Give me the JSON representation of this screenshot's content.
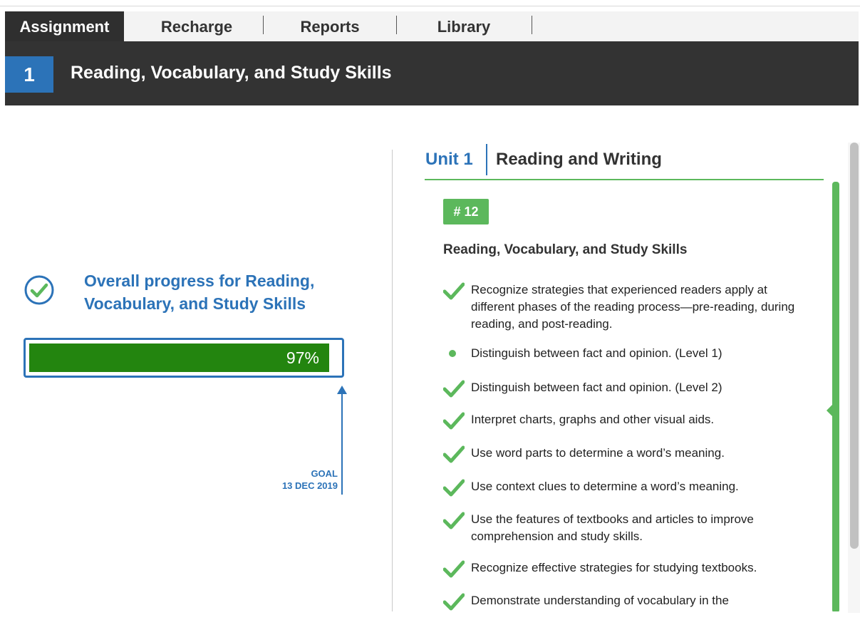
{
  "tabs": [
    {
      "label": "Assignment",
      "active": true
    },
    {
      "label": "Recharge",
      "active": false
    },
    {
      "label": "Reports",
      "active": false
    },
    {
      "label": "Library",
      "active": false
    }
  ],
  "header": {
    "number": "1",
    "title": "Reading, Vocabulary, and Study Skills"
  },
  "progress": {
    "title": "Overall progress for Reading, Vocabulary, and Study Skills",
    "percent_label": "97%",
    "percent": 97,
    "goal_label": "GOAL",
    "goal_date": "13 DEC 2019"
  },
  "unit": {
    "label": "Unit 1",
    "title": "Reading and Writing"
  },
  "lesson": {
    "badge": "# 12",
    "title": "Reading, Vocabulary, and Study Skills",
    "objectives": [
      {
        "text": "Recognize strategies that experienced readers apply at different phases of the reading process—pre-reading, during reading, and post-reading.",
        "status": "complete"
      },
      {
        "text": "Distinguish between fact and opinion. (Level 1)",
        "status": "in-progress"
      },
      {
        "text": "Distinguish between fact and opinion. (Level 2)",
        "status": "complete"
      },
      {
        "text": "Interpret charts, graphs and other visual aids.",
        "status": "complete"
      },
      {
        "text": "Use word parts to determine a word’s meaning.",
        "status": "complete"
      },
      {
        "text": "Use context clues to determine a word’s meaning.",
        "status": "complete"
      },
      {
        "text": "Use the features of textbooks and articles to improve comprehension and study skills.",
        "status": "complete"
      },
      {
        "text": "Recognize effective strategies for studying textbooks.",
        "status": "complete"
      },
      {
        "text": "Demonstrate understanding of vocabulary in the",
        "status": "complete"
      }
    ]
  },
  "colors": {
    "accent": "#2c73b8",
    "progress_fill": "#23850f",
    "check": "#5cb85c",
    "header_bg": "#333333"
  }
}
